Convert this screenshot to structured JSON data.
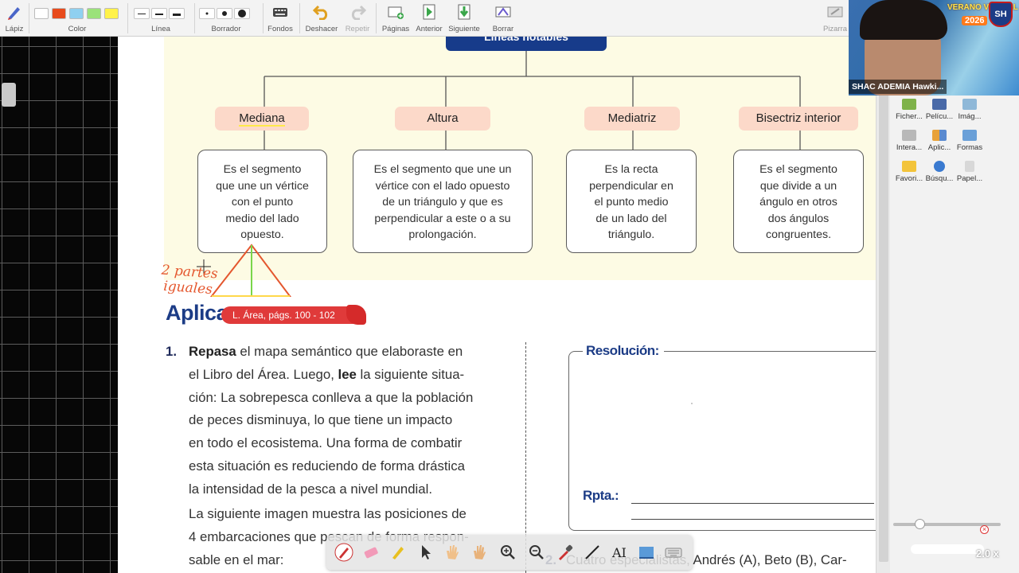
{
  "toolbar": {
    "pencil_label": "Lápiz",
    "color_label": "Color",
    "line_label": "Línea",
    "eraser_label": "Borrador",
    "backgrounds_label": "Fondos",
    "undo_label": "Deshacer",
    "redo_label": "Repetir",
    "pages_label": "Páginas",
    "previous_label": "Anterior",
    "next_label": "Siguiente",
    "clear_label": "Borrar",
    "board_label": "Pizarra",
    "colors": [
      "#ffffff",
      "#e84a1b",
      "#8fd0f0",
      "#9be27a",
      "#fff24a"
    ]
  },
  "map": {
    "header": "Líneas notables",
    "categories": [
      "Mediana",
      "Altura",
      "Mediatriz",
      "Bisectriz interior"
    ],
    "definitions": [
      [
        "Es el segmento",
        "que une un vértice",
        "con el punto",
        "medio del lado",
        "opuesto."
      ],
      [
        "Es el segmento que une un",
        "vértice con el lado opuesto",
        "de un triángulo y que es",
        "perpendicular a este o a su",
        "prolongación."
      ],
      [
        "Es la recta",
        "perpendicular en",
        "el punto medio",
        "de un lado del",
        "triángulo."
      ],
      [
        "Es el segmento",
        "que divide a un",
        "ángulo en otros",
        "dos ángulos",
        "congruentes."
      ]
    ]
  },
  "annotation": {
    "line1": "2 partes",
    "line2": "iguales"
  },
  "section": {
    "title": "Aplica",
    "pill": "L. Área, págs. 100 - 102"
  },
  "exercise1": {
    "number": "1.",
    "lines": [
      [
        "Repasa",
        " el mapa semántico que elaboraste en"
      ],
      [
        "el Libro del Área. Luego, ",
        "lee",
        " la siguiente situa-"
      ],
      [
        "ción: La sobrepesca conlleva a que la población"
      ],
      [
        "de peces disminuya, lo que tiene un impacto"
      ],
      [
        "en todo el ecosistema. Una forma de combatir"
      ],
      [
        "esta situación es reduciendo de forma drástica"
      ],
      [
        "la intensidad de la pesca a nivel mundial."
      ]
    ],
    "para2": [
      "La siguiente imagen muestra las posiciones de",
      "4 embarcaciones que pescan de forma respon-",
      "sable en el mar:"
    ]
  },
  "resolution": {
    "label": "Resolución:",
    "answer_label": "Rpta.:"
  },
  "exercise2": {
    "number": "2.",
    "text": "Cuatro especialistas, Andrés (A), Beto (B), Car-"
  },
  "right_panel": {
    "items": [
      "Ficher...",
      "Pelícu...",
      "Imág...",
      "Intera...",
      "Aplic...",
      "Formas",
      "Favori...",
      "Búsqu...",
      "Papel..."
    ],
    "zoom": "2.0 x"
  },
  "webcam": {
    "banner": "VERANO VIRTUAL",
    "year": "2026",
    "logo": "SH",
    "name": "SHAC ADEMIA Hawki..."
  }
}
